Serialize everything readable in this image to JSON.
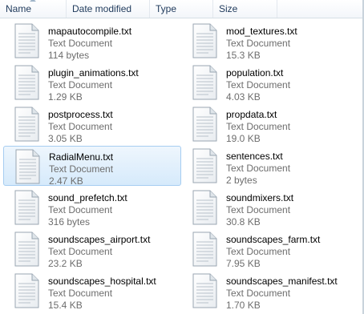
{
  "columns": {
    "name": "Name",
    "date_modified": "Date modified",
    "type": "Type",
    "size": "Size"
  },
  "files": [
    {
      "name": "mapautocompile.txt",
      "type": "Text Document",
      "size": "114 bytes"
    },
    {
      "name": "mod_textures.txt",
      "type": "Text Document",
      "size": "15.3 KB"
    },
    {
      "name": "plugin_animations.txt",
      "type": "Text Document",
      "size": "1.29 KB"
    },
    {
      "name": "population.txt",
      "type": "Text Document",
      "size": "4.03 KB"
    },
    {
      "name": "postprocess.txt",
      "type": "Text Document",
      "size": "3.05 KB"
    },
    {
      "name": "propdata.txt",
      "type": "Text Document",
      "size": "19.0 KB"
    },
    {
      "name": "RadialMenu.txt",
      "type": "Text Document",
      "size": "2.47 KB",
      "selected": true
    },
    {
      "name": "sentences.txt",
      "type": "Text Document",
      "size": "2 bytes"
    },
    {
      "name": "sound_prefetch.txt",
      "type": "Text Document",
      "size": "316 bytes"
    },
    {
      "name": "soundmixers.txt",
      "type": "Text Document",
      "size": "30.8 KB"
    },
    {
      "name": "soundscapes_airport.txt",
      "type": "Text Document",
      "size": "23.2 KB"
    },
    {
      "name": "soundscapes_farm.txt",
      "type": "Text Document",
      "size": "7.95 KB"
    },
    {
      "name": "soundscapes_hospital.txt",
      "type": "Text Document",
      "size": "15.4 KB"
    },
    {
      "name": "soundscapes_manifest.txt",
      "type": "Text Document",
      "size": "1.70 KB"
    }
  ],
  "icon": "text-document-icon",
  "colors": {
    "selection_fill": "#d6eafb",
    "selection_border": "#a6cdf1",
    "header_text": "#1e395b",
    "secondary_text": "#6d6d6d"
  }
}
